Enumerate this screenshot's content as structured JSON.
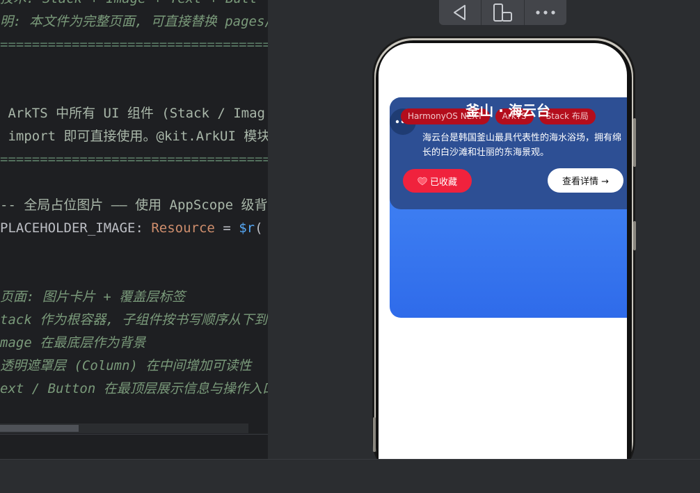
{
  "editor": {
    "lines": [
      {
        "cls": "c-comment",
        "text": "技术: Stack + Image + Text + Butt"
      },
      {
        "cls": "c-comment",
        "text": "明: 本文件为完整页面, 可直接替换 pages/I"
      },
      {
        "cls": "c-sep",
        "text": "====================================="
      },
      {
        "cls": "c-doc",
        "text": " ArkTS 中所有 UI 组件 (Stack / Imag"
      },
      {
        "cls": "c-doc",
        "text": " import 即可直接使用。@kit.ArkUI 模块"
      },
      {
        "cls": "c-sep",
        "text": "====================================="
      },
      {
        "cls": "c-doc",
        "text": "-- 全局占位图片 —— 使用 AppScope 级背"
      },
      {
        "cls": "mixed",
        "parts": [
          {
            "cls": "c-plain",
            "text": "PLACEHOLDER_IMAGE"
          },
          {
            "cls": "c-punc",
            "text": ": "
          },
          {
            "cls": "c-type",
            "text": "Resource"
          },
          {
            "cls": "c-punc",
            "text": " = "
          },
          {
            "cls": "c-func",
            "text": "$r"
          },
          {
            "cls": "c-punc",
            "text": "("
          }
        ]
      },
      {
        "cls": "c-comment",
        "text": "页面: 图片卡片 + 覆盖层标签"
      },
      {
        "cls": "c-comment",
        "text": "tack 作为根容器, 子组件按书写顺序从下到上"
      },
      {
        "cls": "c-comment",
        "text": "mage 在最底层作为背景"
      },
      {
        "cls": "c-comment",
        "text": "透明遮罩层 (Column) 在中间增加可读性"
      },
      {
        "cls": "c-comment",
        "text": "ext / Button 在最顶层展示信息与操作入口"
      }
    ]
  },
  "toolbar": {
    "buttons": [
      {
        "name": "back-icon"
      },
      {
        "name": "device-rotate-icon"
      },
      {
        "name": "more-icon"
      }
    ]
  },
  "card": {
    "title": "釜山 · 海云台",
    "tags": [
      "HarmonyOS NEXT",
      "ArkTS",
      "Stack 布局"
    ],
    "description": "海云台是韩国釜山最具代表性的海水浴场，拥有绵长的白沙滩和壮丽的东海景观。",
    "favorite_label": "已收藏",
    "detail_label": "查看详情 →",
    "colors": {
      "card_gradient_top": "#4a8cf8",
      "overlay": "#2d4f94",
      "tag": "#b30d1c",
      "favorite": "#f0223d"
    }
  }
}
